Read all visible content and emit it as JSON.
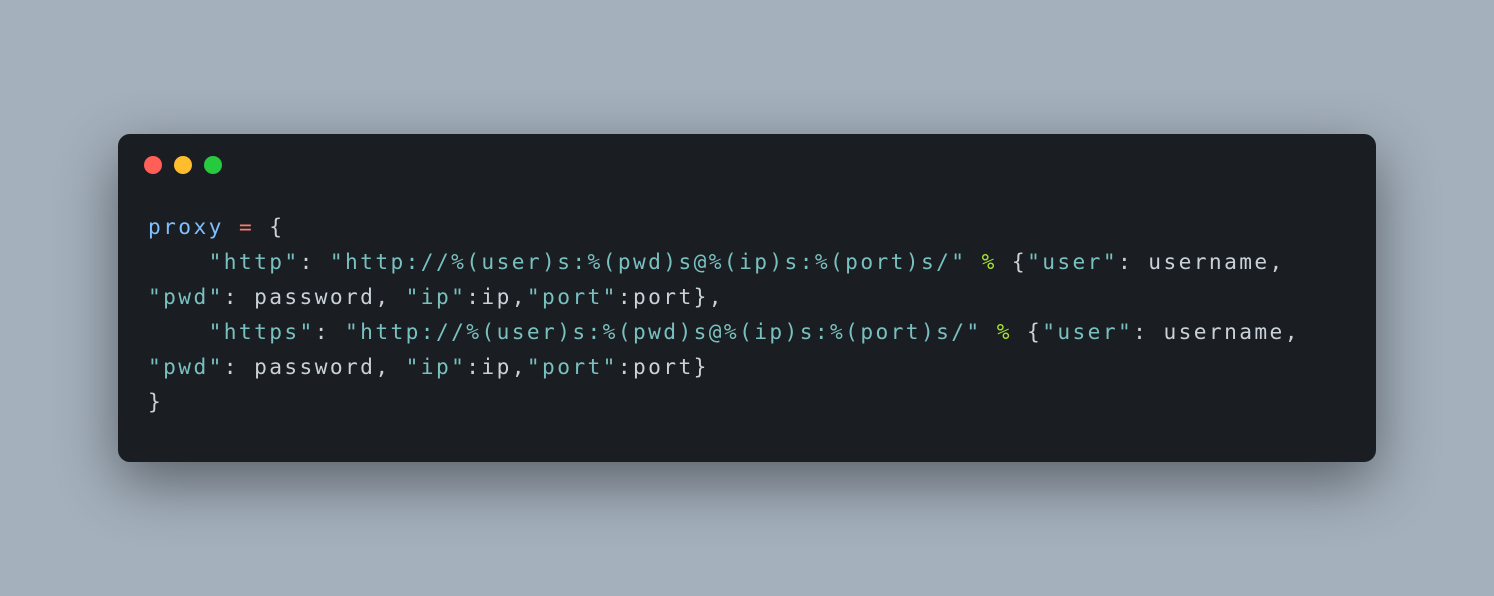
{
  "code": {
    "tokens": [
      {
        "t": "proxy ",
        "c": "tok-ident"
      },
      {
        "t": "=",
        "c": "tok-op"
      },
      {
        "t": " {\n    ",
        "c": "tok-punct"
      },
      {
        "t": "\"http\"",
        "c": "tok-str"
      },
      {
        "t": ": ",
        "c": "tok-punct"
      },
      {
        "t": "\"http://%(user)s:%(pwd)s@%(ip)s:%(port)s/\"",
        "c": "tok-str"
      },
      {
        "t": " ",
        "c": "tok-punct"
      },
      {
        "t": "%",
        "c": "tok-pct"
      },
      {
        "t": " {",
        "c": "tok-punct"
      },
      {
        "t": "\"user\"",
        "c": "tok-str"
      },
      {
        "t": ": username, ",
        "c": "tok-punct"
      },
      {
        "t": "\"pwd\"",
        "c": "tok-str"
      },
      {
        "t": ": password, ",
        "c": "tok-punct"
      },
      {
        "t": "\"ip\"",
        "c": "tok-str"
      },
      {
        "t": ":ip,",
        "c": "tok-punct"
      },
      {
        "t": "\"port\"",
        "c": "tok-str"
      },
      {
        "t": ":port},\n    ",
        "c": "tok-punct"
      },
      {
        "t": "\"https\"",
        "c": "tok-str"
      },
      {
        "t": ": ",
        "c": "tok-punct"
      },
      {
        "t": "\"http://%(user)s:%(pwd)s@%(ip)s:%(port)s/\"",
        "c": "tok-str"
      },
      {
        "t": " ",
        "c": "tok-punct"
      },
      {
        "t": "%",
        "c": "tok-pct"
      },
      {
        "t": " {",
        "c": "tok-punct"
      },
      {
        "t": "\"user\"",
        "c": "tok-str"
      },
      {
        "t": ": username, ",
        "c": "tok-punct"
      },
      {
        "t": "\"pwd\"",
        "c": "tok-str"
      },
      {
        "t": ": password, ",
        "c": "tok-punct"
      },
      {
        "t": "\"ip\"",
        "c": "tok-str"
      },
      {
        "t": ":ip,",
        "c": "tok-punct"
      },
      {
        "t": "\"port\"",
        "c": "tok-str"
      },
      {
        "t": ":port}\n}",
        "c": "tok-punct"
      }
    ]
  }
}
